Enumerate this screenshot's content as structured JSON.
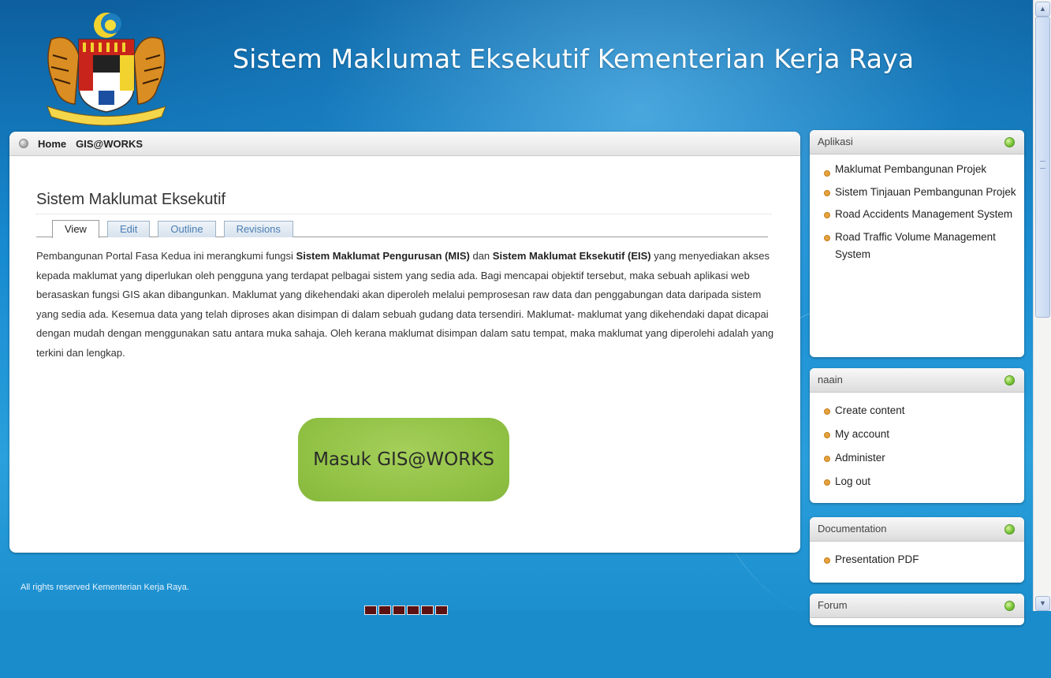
{
  "header": {
    "site_title": "Sistem Maklumat Eksekutif Kementerian Kerja Raya",
    "logo_icon": "malaysia-coat-of-arms-icon"
  },
  "nav": {
    "home": "Home",
    "gisworks": "GIS@WORKS"
  },
  "main": {
    "title": "Sistem Maklumat Eksekutif",
    "tabs": [
      {
        "label": "View",
        "active": true
      },
      {
        "label": "Edit"
      },
      {
        "label": "Outline"
      },
      {
        "label": "Revisions"
      }
    ],
    "body": {
      "p1": "Pembangunan Portal Fasa Kedua ini merangkumi fungsi ",
      "b1": "Sistem Maklumat Pengurusan (MIS)",
      "p2": " dan ",
      "b2": "Sistem Maklumat Eksekutif (EIS)",
      "p3": " yang menyediakan akses kepada maklumat yang diperlukan oleh pengguna yang terdapat pelbagai sistem yang sedia ada. Bagi mencapai objektif tersebut, maka sebuah aplikasi web berasaskan fungsi GIS akan dibangunkan. Maklumat yang dikehendaki akan diperoleh melalui pemprosesan raw data dan penggabungan data daripada sistem yang sedia ada. Kesemua data yang telah diproses akan disimpan di dalam sebuah gudang data tersendiri. Maklumat- maklumat yang dikehendaki dapat dicapai dengan mudah dengan menggunakan satu antara muka sahaja. Oleh kerana maklumat disimpan dalam satu tempat, maka maklumat yang diperolehi adalah yang terkini dan lengkap."
    },
    "gis_button": "Masuk GIS@WORKS"
  },
  "sidebar": {
    "aplikasi": {
      "title": "Aplikasi",
      "items": [
        "Maklumat Pembangunan Projek",
        "Sistem Tinjauan Pembangunan Projek",
        "Road Accidents Management System",
        "Road Traffic Volume Management System"
      ]
    },
    "user": {
      "title": "naain",
      "items": [
        "Create content",
        "My account",
        "Administer",
        "Log out"
      ]
    },
    "documentation": {
      "title": "Documentation",
      "items": [
        "Presentation PDF"
      ]
    },
    "forum": {
      "title": "Forum"
    }
  },
  "footer": {
    "text": "All rights reserved Kementerian Kerja Raya."
  },
  "colors": {
    "background": "#1a8ccc",
    "button_green": "#8fc043",
    "status_green": "#7cc63a",
    "bullet": "#e6a23c",
    "tab_link": "#4b7fb5"
  }
}
